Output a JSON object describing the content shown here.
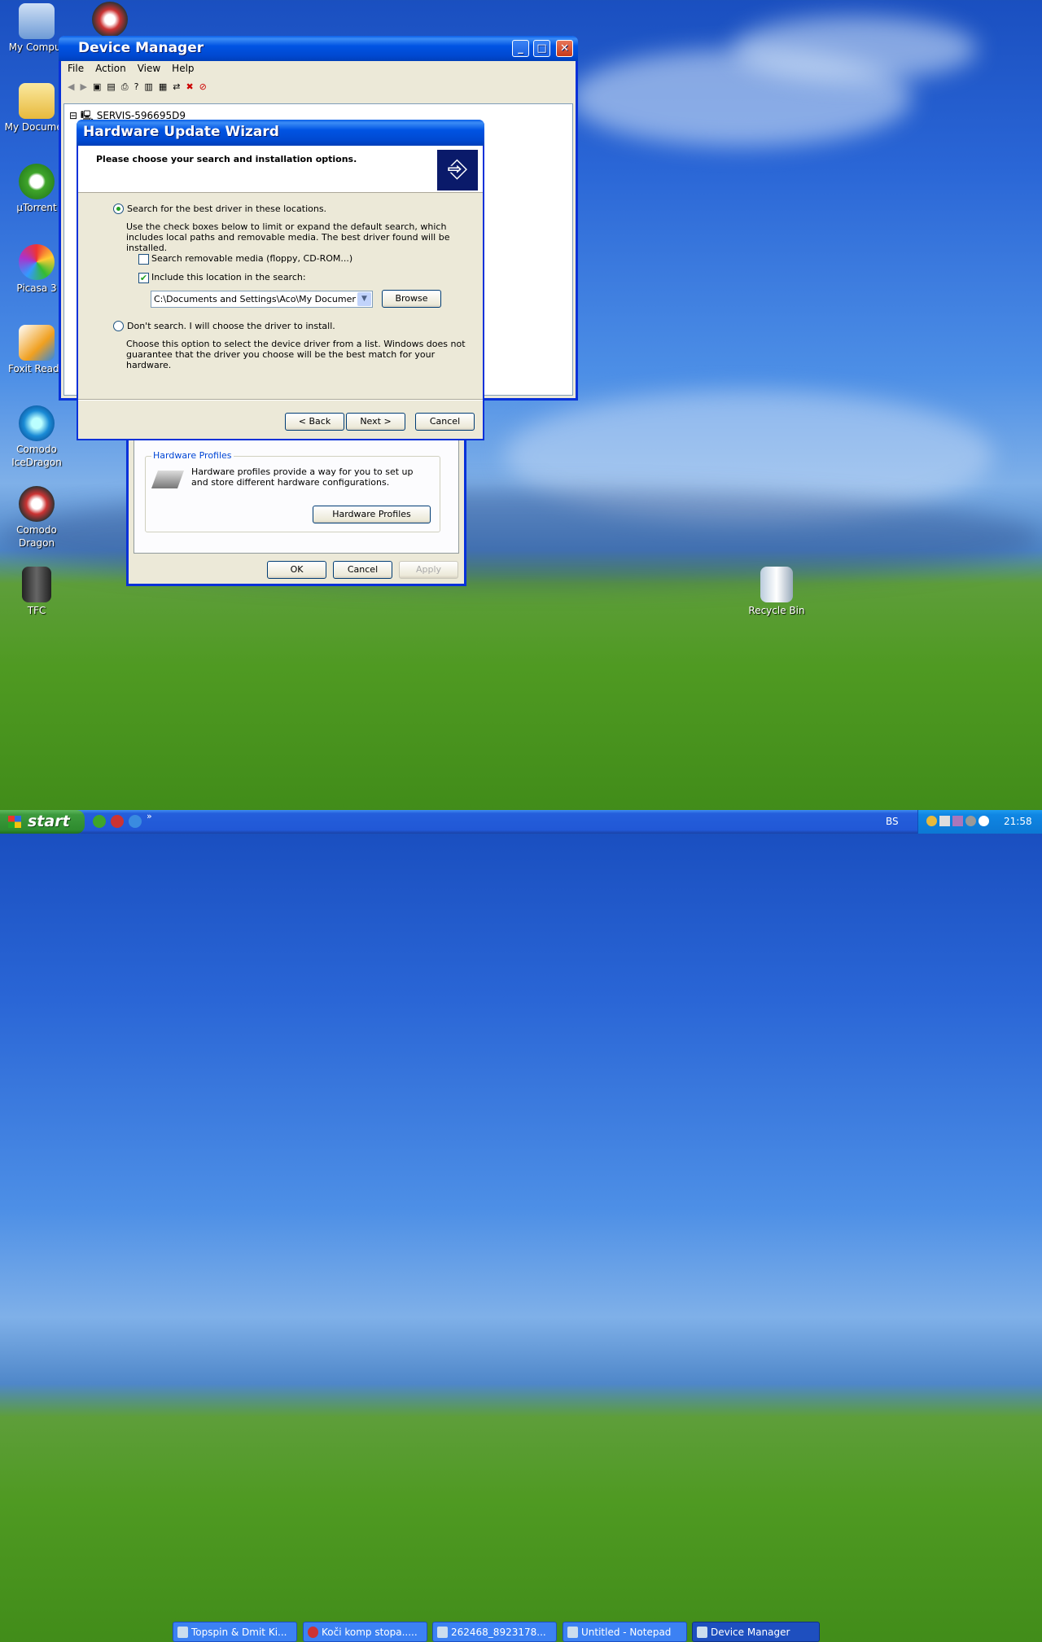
{
  "desktop": {
    "icons": [
      {
        "label": "My Comput"
      },
      {
        "label": "My Documen"
      },
      {
        "label": "µTorrent"
      },
      {
        "label": "Picasa 3"
      },
      {
        "label": "Foxit Reade"
      },
      {
        "label": "Comodo IceDragon"
      },
      {
        "label": "Comodo Dragon"
      },
      {
        "label": "TFC"
      },
      {
        "label": "Recycle Bin"
      }
    ]
  },
  "device_manager": {
    "title": "Device Manager",
    "menu": [
      "File",
      "Action",
      "View",
      "Help"
    ],
    "tree_root": "SERVIS-596695D9"
  },
  "properties": {
    "group_title": "Hardware Profiles",
    "group_text": "Hardware profiles provide a way for you to set up and store different hardware configurations.",
    "profiles_button": "Hardware Profiles",
    "ok": "OK",
    "cancel": "Cancel",
    "apply": "Apply"
  },
  "wizard": {
    "title": "Hardware Update Wizard",
    "header": "Please choose your search and installation options.",
    "option1": "Search for the best driver in these locations.",
    "option1_desc": "Use the check boxes below to limit or expand the default search, which includes local paths and removable media. The best driver found will be installed.",
    "check_removable": "Search removable media (floppy, CD-ROM...)",
    "check_location": "Include this location in the search:",
    "path_value": "C:\\Documents and Settings\\Aco\\My Documents\\Do",
    "browse": "Browse",
    "option2": "Don't search. I will choose the driver to install.",
    "option2_desc": "Choose this option to select the device driver from a list.  Windows does not guarantee that the driver you choose will be the best match for your hardware.",
    "back": "< Back",
    "next": "Next >",
    "cancel": "Cancel"
  },
  "taskbar": {
    "start": "start",
    "chevron": "»",
    "tasks": [
      "Topspin & Dmit Ki...",
      "Koči komp stopa.....",
      "262468_8923178...",
      "Untitled - Notepad",
      "Device Manager"
    ],
    "language": "BS",
    "clock": "21:58"
  }
}
